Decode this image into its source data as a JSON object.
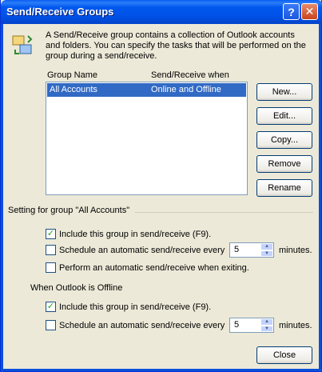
{
  "window": {
    "title": "Send/Receive Groups",
    "help_label": "?",
    "close_label": "✕"
  },
  "description": "A Send/Receive group contains a collection of Outlook accounts and folders. You can specify the tasks that will be performed on the group during a send/receive.",
  "list": {
    "columns": [
      "Group Name",
      "Send/Receive when"
    ],
    "rows": [
      {
        "name": "All Accounts",
        "when": "Online and Offline",
        "selected": true
      }
    ]
  },
  "buttons": {
    "new": "New...",
    "edit": "Edit...",
    "copy": "Copy...",
    "remove": "Remove",
    "rename": "Rename",
    "close": "Close"
  },
  "settings": {
    "group_label": "Setting for group \"All Accounts\"",
    "online": {
      "include": {
        "label": "Include this group in send/receive (F9).",
        "checked": true
      },
      "schedule": {
        "label": "Schedule an automatic send/receive every",
        "checked": false,
        "value": "5",
        "unit": "minutes."
      },
      "exit": {
        "label": "Perform an automatic send/receive when exiting.",
        "checked": false
      }
    },
    "offline_label": "When Outlook is Offline",
    "offline": {
      "include": {
        "label": "Include this group in send/receive (F9).",
        "checked": true
      },
      "schedule": {
        "label": "Schedule an automatic send/receive every",
        "checked": false,
        "value": "5",
        "unit": "minutes."
      }
    }
  },
  "colors": {
    "title_blue": "#0054e3",
    "selection": "#316ac5",
    "dialog_bg": "#ece9d8"
  }
}
